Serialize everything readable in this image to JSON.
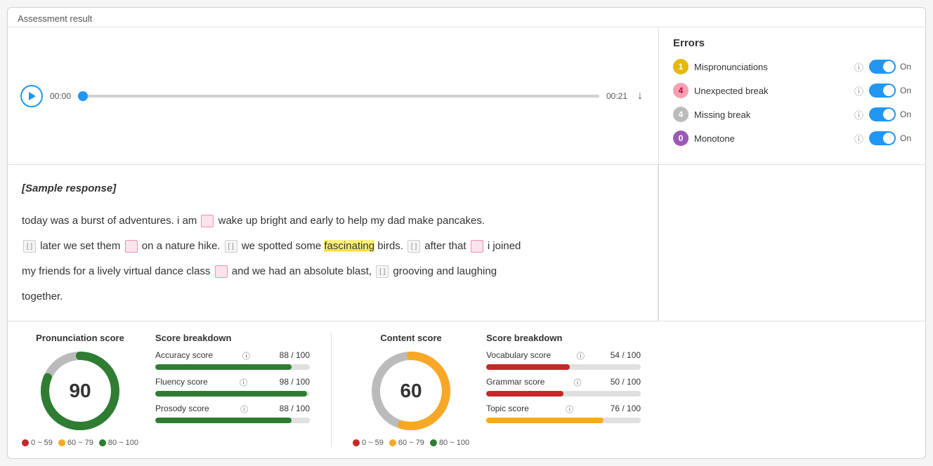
{
  "page": {
    "title": "Assessment result"
  },
  "audio": {
    "time_start": "00:00",
    "time_end": "00:21",
    "progress_percent": 1
  },
  "errors": {
    "title": "Errors",
    "items": [
      {
        "id": "mispronunciations",
        "count": "1",
        "label": "Mispronunciations",
        "badge_class": "badge-yellow",
        "toggle": "On"
      },
      {
        "id": "unexpected-break",
        "count": "4",
        "label": "Unexpected break",
        "badge_class": "badge-pink",
        "toggle": "On"
      },
      {
        "id": "missing-break",
        "count": "4",
        "label": "Missing break",
        "badge_class": "badge-gray",
        "toggle": "On"
      },
      {
        "id": "monotone",
        "count": "0",
        "label": "Monotone",
        "badge_class": "badge-purple",
        "toggle": "On"
      }
    ]
  },
  "transcript": {
    "heading": "[Sample response]",
    "text_lines": [
      "today was a burst of adventures. i am [break] wake up bright and early to help my dad make pancakes.",
      "[ ] later we set them [break] on a nature hike. [ ] we spotted some fascinating birds. [ ] after that [break] i joined",
      "my friends for a lively virtual dance class [break] and we had an absolute blast, [ ] grooving and laughing",
      "together."
    ]
  },
  "pronunciation_score": {
    "title": "Pronunciation score",
    "value": 90,
    "circle_color": "#2e7d32",
    "circle_bg": "#bbb",
    "breakdown_title": "Score breakdown",
    "items": [
      {
        "label": "Accuracy score",
        "value": "88 / 100",
        "percent": 88,
        "bar_class": "green-bar"
      },
      {
        "label": "Fluency score",
        "value": "98 / 100",
        "percent": 98,
        "bar_class": "green-bar"
      },
      {
        "label": "Prosody score",
        "value": "88 / 100",
        "percent": 88,
        "bar_class": "green-bar"
      }
    ],
    "legend": [
      {
        "label": "0 ~ 59",
        "color": "#c62828"
      },
      {
        "label": "60 ~ 79",
        "color": "#f9a825"
      },
      {
        "label": "80 ~ 100",
        "color": "#2e7d32"
      }
    ]
  },
  "content_score": {
    "title": "Content score",
    "value": 60,
    "circle_color": "#f9a825",
    "circle_bg": "#bbb",
    "breakdown_title": "Score breakdown",
    "items": [
      {
        "label": "Vocabulary score",
        "value": "54 / 100",
        "percent": 54,
        "bar_class": "red-bar"
      },
      {
        "label": "Grammar score",
        "value": "50 / 100",
        "percent": 50,
        "bar_class": "red-bar"
      },
      {
        "label": "Topic score",
        "value": "76 / 100",
        "percent": 76,
        "bar_class": "yellow-bar"
      }
    ],
    "legend": [
      {
        "label": "0 ~ 59",
        "color": "#c62828"
      },
      {
        "label": "60 ~ 79",
        "color": "#f9a825"
      },
      {
        "label": "80 ~ 100",
        "color": "#2e7d32"
      }
    ]
  }
}
